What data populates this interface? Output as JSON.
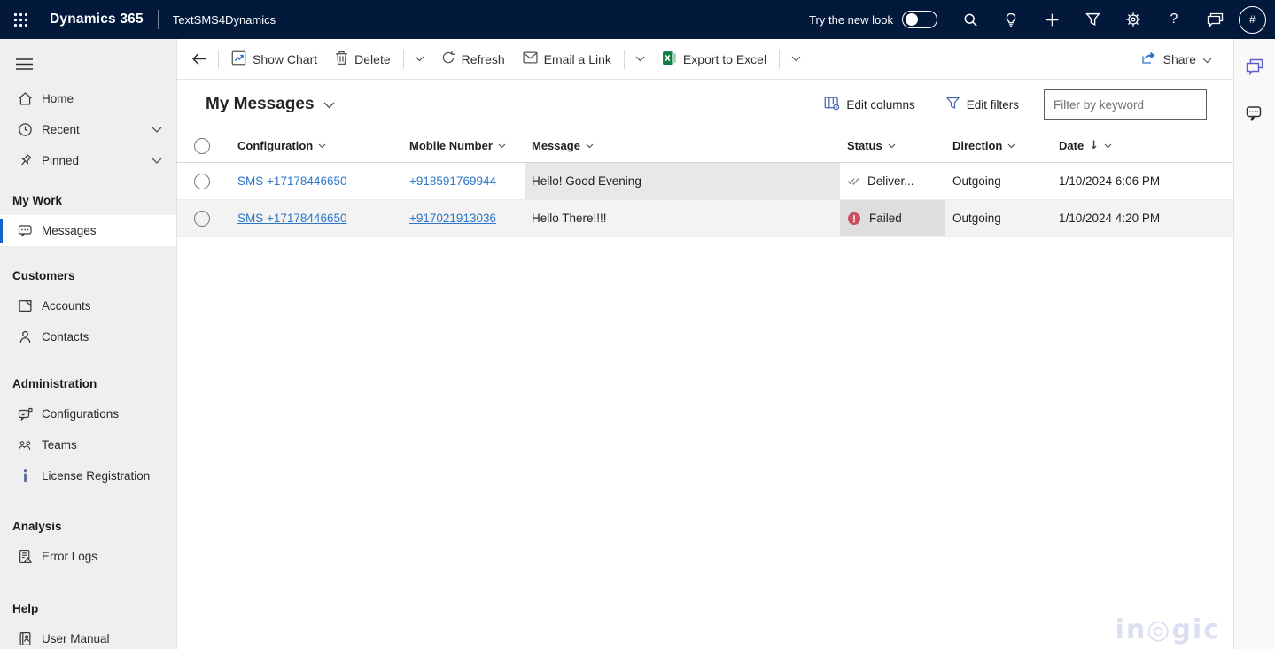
{
  "topbar": {
    "app_name": "Dynamics 365",
    "environment": "TextSMS4Dynamics",
    "new_look_label": "Try the new look",
    "new_look_state": "off",
    "avatar_label": "#"
  },
  "command_bar": {
    "buttons": [
      {
        "label": "Show Chart"
      },
      {
        "label": "Delete",
        "has_dropdown": true
      },
      {
        "label": "Refresh"
      },
      {
        "label": "Email a Link",
        "has_dropdown": true
      },
      {
        "label": "Export to Excel",
        "has_dropdown": true
      }
    ],
    "share_label": "Share"
  },
  "view_header": {
    "title": "My Messages",
    "edit_columns_label": "Edit columns",
    "edit_filters_label": "Edit filters",
    "filter_placeholder": "Filter by keyword"
  },
  "grid": {
    "columns": [
      {
        "label": "Configuration"
      },
      {
        "label": "Mobile Number"
      },
      {
        "label": "Message"
      },
      {
        "label": "Status"
      },
      {
        "label": "Direction"
      },
      {
        "label": "Date",
        "sorted": "descending",
        "sort_arrow": "↓"
      }
    ],
    "rows": [
      {
        "configuration": "SMS +17178446650",
        "mobile_number": "+918591769944",
        "message": "Hello! Good Evening",
        "status": "Deliver...",
        "status_kind": "delivered",
        "direction": "Outgoing",
        "date": "1/10/2024 6:06 PM"
      },
      {
        "configuration": "SMS +17178446650",
        "mobile_number": "+917021913036",
        "message": "Hello There!!!!",
        "status": "Failed",
        "status_kind": "failed",
        "direction": "Outgoing",
        "date": "1/10/2024 4:20 PM"
      }
    ]
  },
  "sidebar": {
    "top_items": [
      {
        "label": "Home",
        "icon": "home-icon"
      },
      {
        "label": "Recent",
        "icon": "clock-icon",
        "collapsible": true
      },
      {
        "label": "Pinned",
        "icon": "pin-icon",
        "collapsible": true
      }
    ],
    "sections": [
      {
        "title": "My Work",
        "items": [
          {
            "label": "Messages",
            "icon": "message-icon",
            "selected": true
          }
        ]
      },
      {
        "title": "Customers",
        "items": [
          {
            "label": "Accounts",
            "icon": "accounts-icon"
          },
          {
            "label": "Contacts",
            "icon": "contacts-icon"
          }
        ]
      },
      {
        "title": "Administration",
        "items": [
          {
            "label": "Configurations",
            "icon": "configuration-icon"
          },
          {
            "label": "Teams",
            "icon": "teams-icon"
          },
          {
            "label": "License Registration",
            "icon": "license-icon"
          }
        ]
      },
      {
        "title": "Analysis",
        "items": [
          {
            "label": "Error Logs",
            "icon": "error-logs-icon"
          }
        ]
      },
      {
        "title": "Help",
        "items": [
          {
            "label": "User Manual",
            "icon": "user-manual-icon"
          }
        ]
      }
    ]
  },
  "watermark": {
    "text": "in◎gic"
  },
  "colors": {
    "topbar_bg": "#03193c",
    "link_blue": "#2e77c9",
    "selected_bar_blue": "#1267cb",
    "failed_red": "#c94f60",
    "excel_green": "#107c41",
    "action_icon_blue": "#4464ad",
    "copilot_purple": "#5b5fc7"
  }
}
